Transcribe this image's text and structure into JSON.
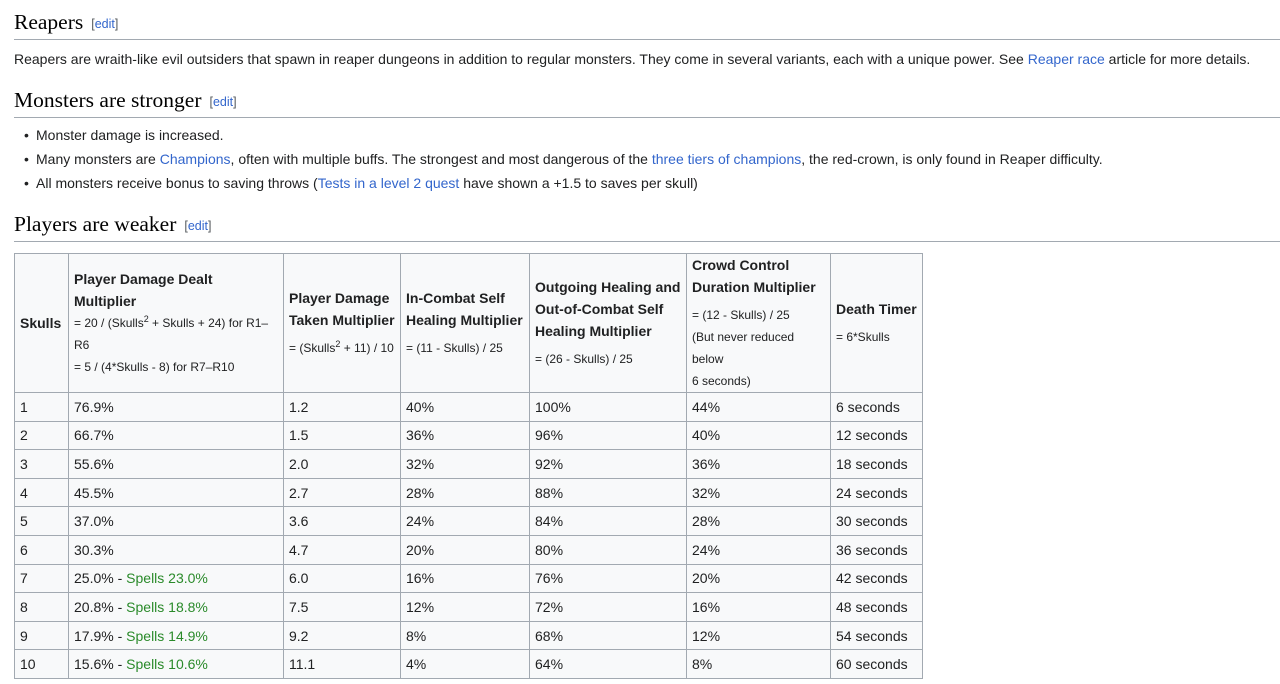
{
  "reapers": {
    "heading": "Reapers",
    "edit_label": "edit",
    "text_before": "Reapers are wraith-like evil outsiders that spawn in reaper dungeons in addition to regular monsters. They come in several variants, each with a unique power. See ",
    "link": "Reaper race",
    "text_after": " article for more details."
  },
  "monsters": {
    "heading": "Monsters are stronger",
    "edit_label": "edit",
    "bullet1": "Monster damage is increased.",
    "bullet2_a": "Many monsters are ",
    "bullet2_link1": "Champions",
    "bullet2_b": ", often with multiple buffs. The strongest and most dangerous of the ",
    "bullet2_link2": "three tiers of champions",
    "bullet2_c": ", the red-crown, is only found in Reaper difficulty.",
    "bullet3_a": "All monsters receive bonus to saving throws (",
    "bullet3_link": "Tests in a level 2 quest",
    "bullet3_b": " have shown a +1.5 to saves per skull)"
  },
  "players": {
    "heading": "Players are weaker",
    "edit_label": "edit"
  },
  "table": {
    "headers": {
      "skulls": "Skulls",
      "dmg_title": "Player Damage Dealt Multiplier",
      "dmg_f1a": "= 20 / (Skulls",
      "dmg_f1b": " + Skulls + 24) for R1–R6",
      "dmg_f2": "= 5 / (4*Skulls - 8) for R7–R10",
      "taken_title_1": "Player Damage",
      "taken_title_2": "Taken Multiplier",
      "taken_f_a": "= (Skulls",
      "taken_f_b": " + 11) / 10",
      "heal_title_1": "In-Combat Self",
      "heal_title_2": "Healing Multiplier",
      "heal_f": "= (11 - Skulls) / 25",
      "out_title_1": "Outgoing Healing and",
      "out_title_2": "Out-of-Combat Self",
      "out_title_3": "Healing Multiplier",
      "out_f": "= (26 - Skulls) / 25",
      "cc_title_1": "Crowd Control",
      "cc_title_2": "Duration Multiplier",
      "cc_f1": "= (12 - Skulls) / 25",
      "cc_f2": "(But never reduced below",
      "cc_f3": "6 seconds)",
      "death_title": "Death Timer",
      "death_f": "= 6*Skulls",
      "sup": "2"
    },
    "rows": [
      {
        "skulls": "1",
        "dmg": "76.9%",
        "spells": "",
        "taken": "1.2",
        "heal": "40%",
        "out": "100%",
        "cc": "44%",
        "death": "6 seconds"
      },
      {
        "skulls": "2",
        "dmg": "66.7%",
        "spells": "",
        "taken": "1.5",
        "heal": "36%",
        "out": "96%",
        "cc": "40%",
        "death": "12 seconds"
      },
      {
        "skulls": "3",
        "dmg": "55.6%",
        "spells": "",
        "taken": "2.0",
        "heal": "32%",
        "out": "92%",
        "cc": "36%",
        "death": "18 seconds"
      },
      {
        "skulls": "4",
        "dmg": "45.5%",
        "spells": "",
        "taken": "2.7",
        "heal": "28%",
        "out": "88%",
        "cc": "32%",
        "death": "24 seconds"
      },
      {
        "skulls": "5",
        "dmg": "37.0%",
        "spells": "",
        "taken": "3.6",
        "heal": "24%",
        "out": "84%",
        "cc": "28%",
        "death": "30 seconds"
      },
      {
        "skulls": "6",
        "dmg": "30.3%",
        "spells": "",
        "taken": "4.7",
        "heal": "20%",
        "out": "80%",
        "cc": "24%",
        "death": "36 seconds"
      },
      {
        "skulls": "7",
        "dmg": "25.0%",
        "spells": "Spells 23.0%",
        "taken": "6.0",
        "heal": "16%",
        "out": "76%",
        "cc": "20%",
        "death": "42 seconds"
      },
      {
        "skulls": "8",
        "dmg": "20.8%",
        "spells": "Spells 18.8%",
        "taken": "7.5",
        "heal": "12%",
        "out": "72%",
        "cc": "16%",
        "death": "48 seconds"
      },
      {
        "skulls": "9",
        "dmg": "17.9%",
        "spells": "Spells 14.9%",
        "taken": "9.2",
        "heal": "8%",
        "out": "68%",
        "cc": "12%",
        "death": "54 seconds"
      },
      {
        "skulls": "10",
        "dmg": "15.6%",
        "spells": "Spells 10.6%",
        "taken": "11.1",
        "heal": "4%",
        "out": "64%",
        "cc": "8%",
        "death": "60 seconds"
      }
    ],
    "spell_separator": " - ",
    "spell_color": "#2a8a2a"
  }
}
